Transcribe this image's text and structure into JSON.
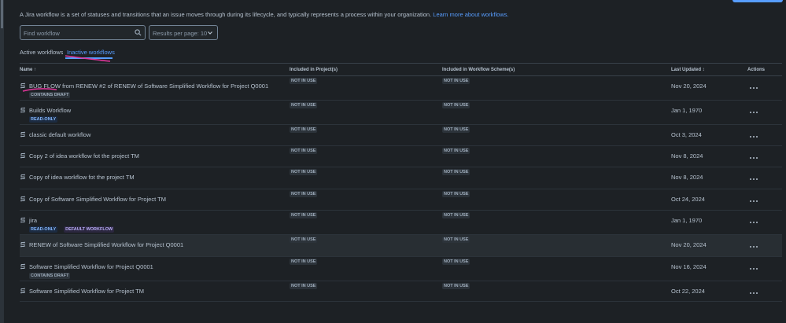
{
  "intro": {
    "text": "A Jira workflow is a set of statuses and transitions that an issue moves through during its lifecycle, and typically represents a process within your organization.",
    "link": "Learn more about workflows."
  },
  "search": {
    "placeholder": "Find workflow",
    "icon": "search-icon"
  },
  "per_page": {
    "label": "Results per page: 10",
    "icon": "chevron-down-icon"
  },
  "tabs": [
    {
      "label": "Active workflows",
      "selected": false
    },
    {
      "label": "Inactive workflows",
      "selected": true
    }
  ],
  "table": {
    "headers": {
      "name": "Name ↑",
      "projects": "Included in Project(s)",
      "schemes": "Included in Workflow Scheme(s)",
      "updated": "Last Updated ↕",
      "actions": "Actions"
    },
    "rows": [
      {
        "name": "BUG FLOW from RENEW #2 of RENEW of Software Simplified Workflow for Project Q0001",
        "projects": "NOT IN USE",
        "schemes": "NOT IN USE",
        "updated": "Nov 20, 2024",
        "badges": [
          "CONTAINS DRAFT"
        ]
      },
      {
        "name": "Builds Workflow",
        "projects": "NOT IN USE",
        "schemes": "NOT IN USE",
        "updated": "Jan 1, 1970",
        "badges": [
          "READ-ONLY"
        ]
      },
      {
        "name": "classic default workflow",
        "projects": "NOT IN USE",
        "schemes": "NOT IN USE",
        "updated": "Oct 3, 2024",
        "badges": []
      },
      {
        "name": "Copy 2 of idea workflow fot the project TM",
        "projects": "NOT IN USE",
        "schemes": "NOT IN USE",
        "updated": "Nov 8, 2024",
        "badges": []
      },
      {
        "name": "Copy of idea workflow fot the project TM",
        "projects": "NOT IN USE",
        "schemes": "NOT IN USE",
        "updated": "Nov 8, 2024",
        "badges": []
      },
      {
        "name": "Copy of Software Simplified Workflow for Project TM",
        "projects": "NOT IN USE",
        "schemes": "NOT IN USE",
        "updated": "Oct 24, 2024",
        "badges": []
      },
      {
        "name": "jira",
        "projects": "NOT IN USE",
        "schemes": "NOT IN USE",
        "updated": "Jan 1, 1970",
        "badges": [
          "READ-ONLY",
          "DEFAULT WORKFLOW"
        ]
      },
      {
        "name": "RENEW of Software Simplified Workflow for Project Q0001",
        "projects": "NOT IN USE",
        "schemes": "NOT IN USE",
        "updated": "Nov 20, 2024",
        "badges": []
      },
      {
        "name": "Software Simplified Workflow for Project Q0001",
        "projects": "NOT IN USE",
        "schemes": "NOT IN USE",
        "updated": "Nov 16, 2024",
        "badges": [
          "CONTAINS DRAFT"
        ]
      },
      {
        "name": "Software Simplified Workflow for Project TM",
        "projects": "NOT IN USE",
        "schemes": "NOT IN USE",
        "updated": "Oct 22, 2024",
        "badges": []
      }
    ]
  },
  "row_icon": "workflow-icon",
  "more_icon": "more-actions-icon",
  "colors": {
    "accent": "#579dff",
    "annotation": "#e0359a",
    "background": "#1d2125"
  }
}
